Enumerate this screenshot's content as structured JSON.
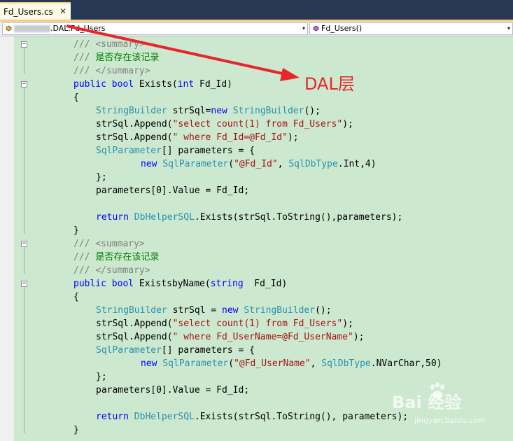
{
  "tab": {
    "title": "Fd_Users.cs",
    "close_glyph": "✕"
  },
  "nav": {
    "left_combo": ".DAL.Fd_Users",
    "right_combo": "Fd_Users()",
    "drop_glyph": "▾"
  },
  "code_lines": [
    [
      [
        "g",
        "/// "
      ],
      [
        "g",
        "<summary>"
      ]
    ],
    [
      [
        "g",
        "/// "
      ],
      [
        "c",
        "是否存在该记录"
      ]
    ],
    [
      [
        "g",
        "/// "
      ],
      [
        "g",
        "</summary>"
      ]
    ],
    [
      [
        "k",
        "public"
      ],
      [
        "n",
        " "
      ],
      [
        "k",
        "bool"
      ],
      [
        "n",
        " Exists("
      ],
      [
        "k",
        "int"
      ],
      [
        "n",
        " Fd_Id)"
      ]
    ],
    [
      [
        "n",
        "{"
      ]
    ],
    [
      [
        "t",
        "StringBuilder"
      ],
      [
        "n",
        " strSql="
      ],
      [
        "k",
        "new"
      ],
      [
        "n",
        " "
      ],
      [
        "t",
        "StringBuilder"
      ],
      [
        "n",
        "();"
      ]
    ],
    [
      [
        "n",
        "strSql.Append("
      ],
      [
        "s",
        "\"select count(1) from Fd_Users\""
      ],
      [
        "n",
        ");"
      ]
    ],
    [
      [
        "n",
        "strSql.Append("
      ],
      [
        "s",
        "\" where Fd_Id=@Fd_Id\""
      ],
      [
        "n",
        ");"
      ]
    ],
    [
      [
        "t",
        "SqlParameter"
      ],
      [
        "n",
        "[] parameters = {"
      ]
    ],
    [
      [
        "k",
        "new"
      ],
      [
        "n",
        " "
      ],
      [
        "t",
        "SqlParameter"
      ],
      [
        "n",
        "("
      ],
      [
        "s",
        "\"@Fd_Id\""
      ],
      [
        "n",
        ", "
      ],
      [
        "t",
        "SqlDbType"
      ],
      [
        "n",
        ".Int,4)"
      ]
    ],
    [
      [
        "n",
        "};"
      ]
    ],
    [
      [
        "n",
        "parameters[0].Value = Fd_Id;"
      ]
    ],
    [],
    [
      [
        "k",
        "return"
      ],
      [
        "n",
        " "
      ],
      [
        "t",
        "DbHelperSQL"
      ],
      [
        "n",
        ".Exists(strSql.ToString(),parameters);"
      ]
    ],
    [
      [
        "n",
        "}"
      ]
    ],
    [
      [
        "g",
        "/// "
      ],
      [
        "g",
        "<summary>"
      ]
    ],
    [
      [
        "g",
        "/// "
      ],
      [
        "c",
        "是否存在该记录"
      ]
    ],
    [
      [
        "g",
        "/// "
      ],
      [
        "g",
        "</summary>"
      ]
    ],
    [
      [
        "k",
        "public"
      ],
      [
        "n",
        " "
      ],
      [
        "k",
        "bool"
      ],
      [
        "n",
        " ExistsbyName("
      ],
      [
        "k",
        "string"
      ],
      [
        "n",
        "  Fd_Id)"
      ]
    ],
    [
      [
        "n",
        "{"
      ]
    ],
    [
      [
        "t",
        "StringBuilder"
      ],
      [
        "n",
        " strSql = "
      ],
      [
        "k",
        "new"
      ],
      [
        "n",
        " "
      ],
      [
        "t",
        "StringBuilder"
      ],
      [
        "n",
        "();"
      ]
    ],
    [
      [
        "n",
        "strSql.Append("
      ],
      [
        "s",
        "\"select count(1) from Fd_Users\""
      ],
      [
        "n",
        ");"
      ]
    ],
    [
      [
        "n",
        "strSql.Append("
      ],
      [
        "s",
        "\" where Fd_UserName=@Fd_UserName\""
      ],
      [
        "n",
        ");"
      ]
    ],
    [
      [
        "t",
        "SqlParameter"
      ],
      [
        "n",
        "[] parameters = {"
      ]
    ],
    [
      [
        "k",
        "new"
      ],
      [
        "n",
        " "
      ],
      [
        "t",
        "SqlParameter"
      ],
      [
        "n",
        "("
      ],
      [
        "s",
        "\"@Fd_UserName\""
      ],
      [
        "n",
        ", "
      ],
      [
        "t",
        "SqlDbType"
      ],
      [
        "n",
        ".NVarChar,50)"
      ]
    ],
    [
      [
        "n",
        "};"
      ]
    ],
    [
      [
        "n",
        "parameters[0].Value = Fd_Id;"
      ]
    ],
    [],
    [
      [
        "k",
        "return"
      ],
      [
        "n",
        " "
      ],
      [
        "t",
        "DbHelperSQL"
      ],
      [
        "n",
        ".Exists(strSql.ToString(), parameters);"
      ]
    ],
    [
      [
        "n",
        "}"
      ]
    ]
  ],
  "annotation": {
    "label": "DAL层",
    "color": "#e8262a"
  },
  "watermark": {
    "text": "Bai   经验",
    "sub": "jingyan.baidu.com"
  },
  "colors": {
    "keyword": "#0000ff",
    "type": "#2b91af",
    "string": "#a31515",
    "comment": "#008000",
    "doc_tag": "#808080",
    "editor_bg": "#cce8cf",
    "tab_bar": "#293955"
  }
}
